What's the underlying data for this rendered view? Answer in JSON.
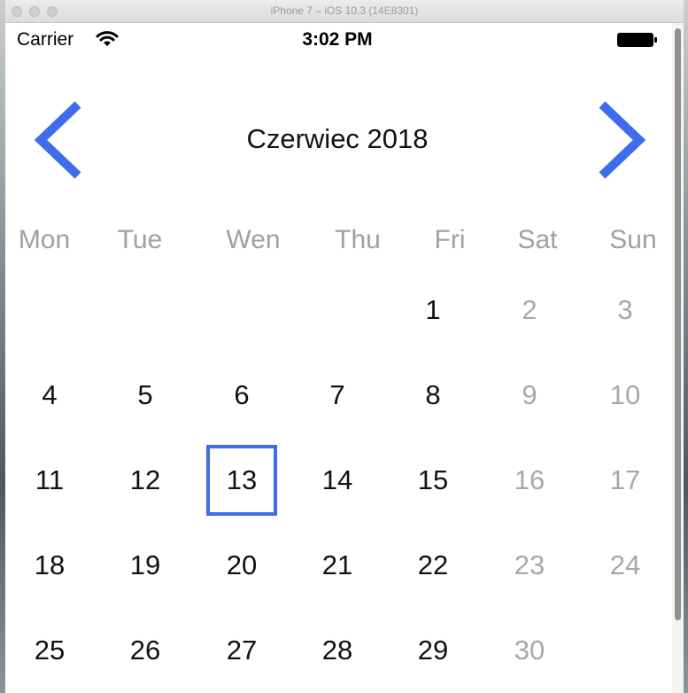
{
  "window": {
    "title": "iPhone 7 – iOS 10.3 (14E8301)"
  },
  "status_bar": {
    "carrier": "Carrier",
    "time": "3:02 PM"
  },
  "calendar": {
    "month_title": "Czerwiec 2018",
    "accent_color": "#3c6df0",
    "weekdays": [
      "Mon",
      "Tue",
      "Wen",
      "Thu",
      "Fri",
      "Sat",
      "Sun"
    ],
    "selected_day": "13",
    "weeks": [
      [
        "",
        "",
        "",
        "",
        "1",
        "2",
        "3"
      ],
      [
        "4",
        "5",
        "6",
        "7",
        "8",
        "9",
        "10"
      ],
      [
        "11",
        "12",
        "13",
        "14",
        "15",
        "16",
        "17"
      ],
      [
        "18",
        "19",
        "20",
        "21",
        "22",
        "23",
        "24"
      ],
      [
        "25",
        "26",
        "27",
        "28",
        "29",
        "30",
        ""
      ]
    ]
  }
}
